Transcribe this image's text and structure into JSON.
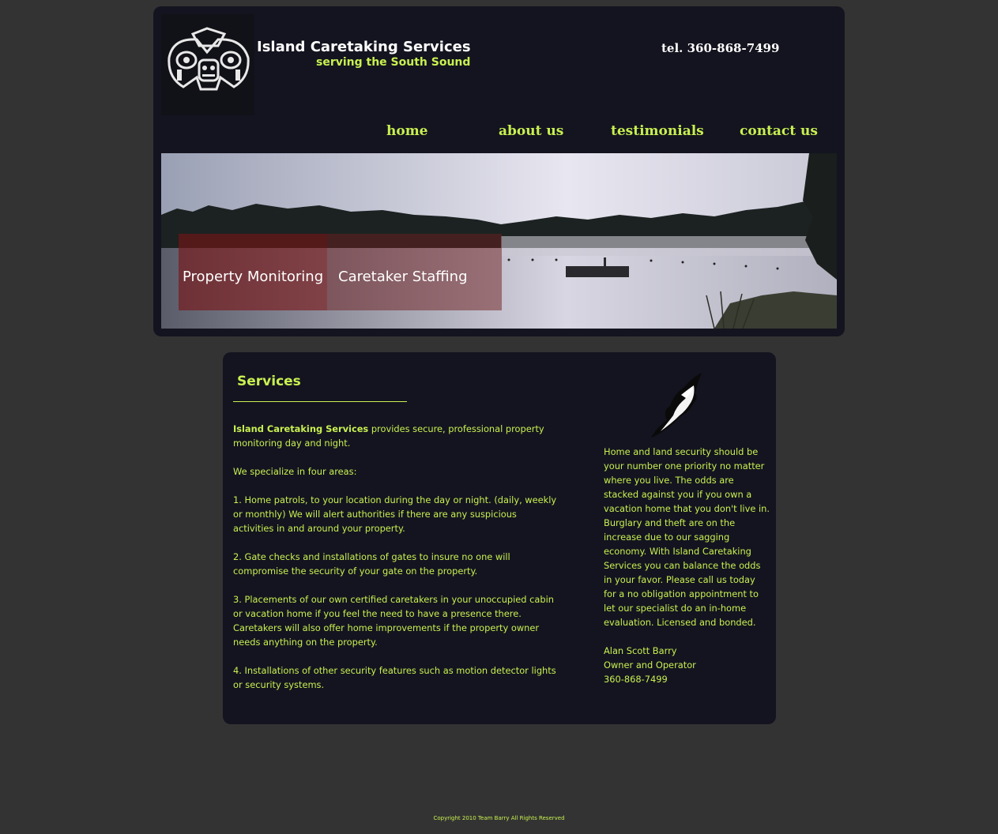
{
  "header": {
    "site_title": "Island Caretaking Services",
    "tagline": "serving the South Sound",
    "phone": "tel.  360-868-7499"
  },
  "nav": {
    "home": "home",
    "about": "about us",
    "testimonials": "testimonials",
    "contact": "contact us"
  },
  "banner": {
    "label_1": "Property Monitoring",
    "label_2": "Caretaker Staffing"
  },
  "services": {
    "heading": "Services",
    "intro_strong": "Island Caretaking Services",
    "intro_rest": " provides secure, professional property monitoring day and night.",
    "specialize": "We specialize in four areas:",
    "item_1": "1.  Home patrols, to your location during the day or night. (daily, weekly or monthly) We will alert authorities if there are any suspicious activities in and around your property.",
    "item_2": "2.  Gate checks and installations of gates to insure no one will compromise the security of your gate on the property.",
    "item_3": "3.  Placements of our own certified caretakers in your unoccupied cabin or vacation home if you feel the need to have a presence there.  Caretakers will also offer home improvements if the property owner needs anything on the property.",
    "item_4": "4.  Installations of other security features such as motion detector lights or security systems."
  },
  "sidebar": {
    "pitch": "Home and land security should be your number one priority no matter where you live. The odds are stacked against you if you own a vacation home that you don't live in. Burglary and theft are on the increase due to our sagging economy. With Island Caretaking Services you can balance the odds in your favor. Please call us today for a no obligation appointment to let our specialist do an in-home evaluation. Licensed and bonded.",
    "owner_name": "Alan Scott Barry",
    "owner_title": "Owner and Operator",
    "owner_phone": "360-868-7499"
  },
  "footer": {
    "copyright": "Copyright 2010 Team Barry   All Rights Reserved"
  },
  "colors": {
    "page_bg": "#333333",
    "panel_bg": "#141420",
    "accent": "#c8f050",
    "title_white": "#ffffff"
  }
}
